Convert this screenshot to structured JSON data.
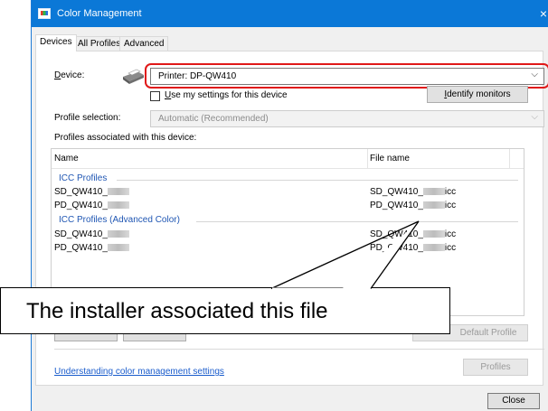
{
  "window": {
    "title": "Color Management",
    "close_glyph": "×"
  },
  "tabs": [
    {
      "label": "Devices",
      "active": true
    },
    {
      "label": "All Profiles",
      "active": false
    },
    {
      "label": "Advanced",
      "active": false
    }
  ],
  "device": {
    "label": "Device:",
    "value": "Printer: DP-QW410",
    "chevron": "⌵"
  },
  "use_settings": {
    "label": "Use my settings for this device",
    "checked": false
  },
  "identify_monitors_label": "Identify monitors",
  "profile_selection": {
    "label": "Profile selection:",
    "value": "Automatic (Recommended)",
    "chevron": "⌵"
  },
  "profiles_label": "Profiles associated with this device:",
  "list": {
    "columns": [
      "Name",
      "File name"
    ],
    "groups": [
      {
        "title": "ICC Profiles",
        "rows": [
          {
            "name": "SD_QW410_",
            "file_prefix": "SD_QW410_",
            "file_suffix": "icc"
          },
          {
            "name": "PD_QW410_",
            "file_prefix": "PD_QW410_",
            "file_suffix": "icc"
          }
        ]
      },
      {
        "title": "ICC Profiles (Advanced Color)",
        "rows": [
          {
            "name": "SD_QW410_",
            "file_prefix": "SD_QW410_",
            "file_suffix": "icc"
          },
          {
            "name": "PD_QW410_",
            "file_prefix": "PD_QW410_",
            "file_suffix": "icc"
          }
        ]
      }
    ]
  },
  "buttons": {
    "default_profile": "Default Profile",
    "profiles": "Profiles",
    "close": "Close"
  },
  "understanding_link": "Understanding color management settings",
  "callout_text": "The installer associated this file",
  "colors": {
    "titlebar": "#0b78d7",
    "highlight_outline": "#e01818",
    "link": "#1a5ccc"
  }
}
